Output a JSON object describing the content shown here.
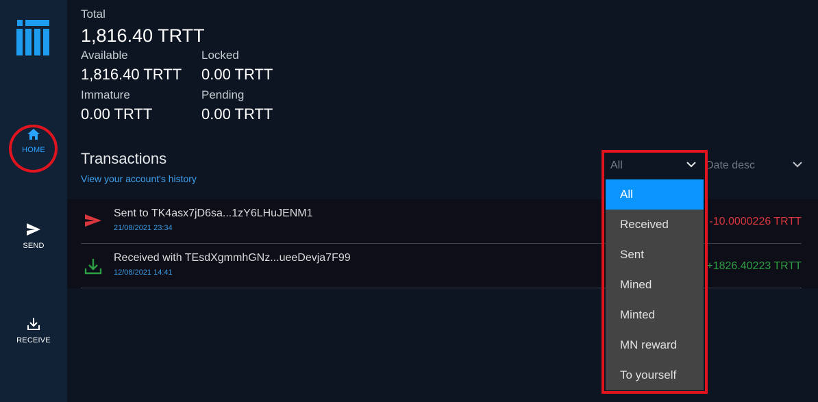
{
  "sidebar": {
    "items": [
      {
        "label": "HOME",
        "icon": "home-icon",
        "active": true
      },
      {
        "label": "SEND",
        "icon": "send-icon"
      },
      {
        "label": "RECEIVE",
        "icon": "receive-icon"
      }
    ]
  },
  "balances": {
    "total": {
      "label": "Total",
      "value": "1,816.40 TRTT"
    },
    "available": {
      "label": "Available",
      "value": "1,816.40 TRTT"
    },
    "locked": {
      "label": "Locked",
      "value": "0.00 TRTT"
    },
    "immature": {
      "label": "Immature",
      "value": "0.00 TRTT"
    },
    "pending": {
      "label": "Pending",
      "value": "0.00 TRTT"
    }
  },
  "transactions": {
    "title": "Transactions",
    "subtitle": "View your account's history",
    "filter": {
      "value": "All",
      "options": [
        "All",
        "Received",
        "Sent",
        "Mined",
        "Minted",
        "MN reward",
        "To yourself"
      ],
      "selected_index": 0
    },
    "sort": {
      "value": "Date desc"
    },
    "items": [
      {
        "description": "Sent to TK4asx7jD6sa...1zY6LHuJENM1",
        "date": "21/08/2021 23:34",
        "amount": "-10.0000226 TRTT",
        "type": "sent",
        "icon": "send-icon"
      },
      {
        "description": "Received with TEsdXgmmhGNz...ueeDevja7F99",
        "date": "12/08/2021 14:41",
        "amount": "+1826.40223 TRTT",
        "type": "received",
        "icon": "download-icon"
      }
    ]
  },
  "colors": {
    "accent": "#2aa2ff",
    "sent": "#d9363e",
    "received": "#2e9e44",
    "highlight": "#e0141e",
    "dropdown_selected": "#0a95ff"
  }
}
